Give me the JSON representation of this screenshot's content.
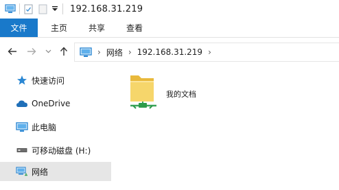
{
  "window": {
    "title": "192.168.31.219"
  },
  "ribbon": {
    "tabs": [
      {
        "label": "文件",
        "active": true
      },
      {
        "label": "主页"
      },
      {
        "label": "共享"
      },
      {
        "label": "查看"
      }
    ]
  },
  "address": {
    "segments": [
      "网络",
      "192.168.31.219"
    ]
  },
  "sidebar": {
    "items": [
      {
        "label": "快速访问",
        "icon": "star-icon"
      },
      {
        "label": "OneDrive",
        "icon": "cloud-icon"
      },
      {
        "label": "此电脑",
        "icon": "computer-icon"
      },
      {
        "label": "可移动磁盘 (H:)",
        "icon": "usb-drive-icon"
      },
      {
        "label": "网络",
        "icon": "network-icon",
        "selected": true
      }
    ]
  },
  "content": {
    "items": [
      {
        "label": "我的文档",
        "icon": "network-folder-icon"
      }
    ]
  },
  "colors": {
    "accent": "#1979ca",
    "selected_bg": "#e6e6e6"
  }
}
